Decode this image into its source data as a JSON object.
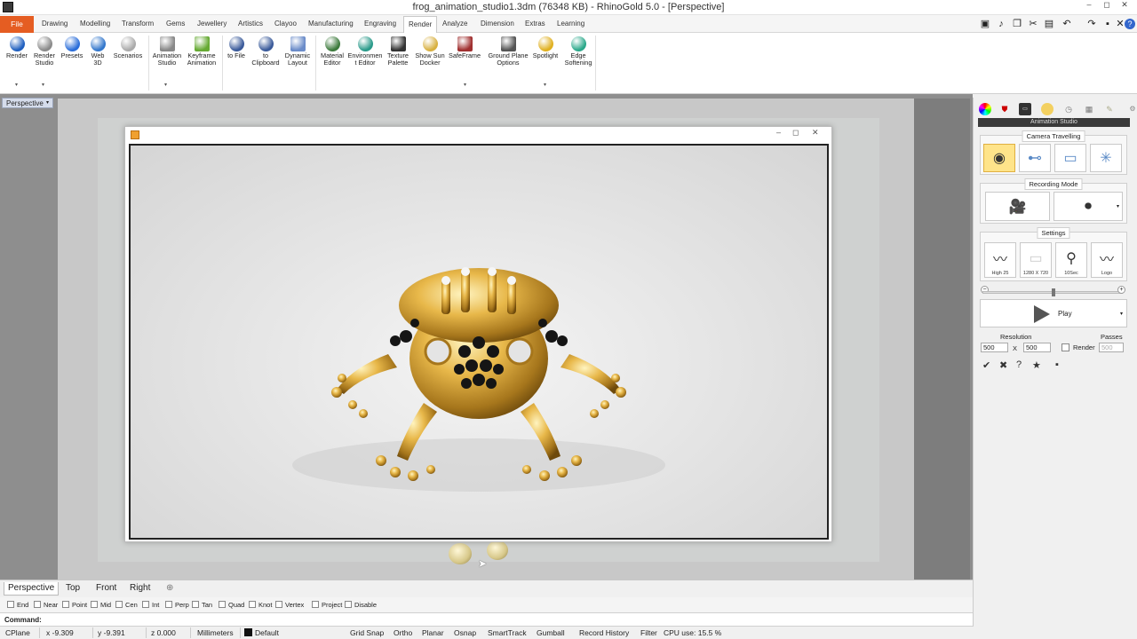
{
  "window": {
    "title": "frog_animation_studio1.3dm (76348 KB) - RhinoGold 5.0 - [Perspective]",
    "controls": [
      "–",
      "◻",
      "✕"
    ]
  },
  "menu": {
    "file": "File",
    "tabs": [
      "Drawing",
      "Modelling",
      "Transform",
      "Gems",
      "Jewellery",
      "Artistics",
      "Clayoo",
      "Manufacturing",
      "Engraving",
      "Render",
      "Analyze",
      "Dimension",
      "Extras",
      "Learning"
    ],
    "active_tab": "Render"
  },
  "quick_access_icons": [
    "film-icon",
    "microphone-icon",
    "copy-icon",
    "scissors-icon",
    "paste-icon",
    "undo-icon",
    "redo-icon",
    "save-icon",
    "close-icon",
    "help-icon"
  ],
  "ribbon": {
    "buttons": [
      {
        "label": "Render",
        "icon": "render-sphere-icon",
        "color": "#1f5fbf"
      },
      {
        "label": "Render\nStudio",
        "icon": "render-studio-icon",
        "color": "#8a8a8a"
      },
      {
        "label": "Presets",
        "icon": "presets-icon",
        "color": "#2a6dd9"
      },
      {
        "label": "Web\n3D",
        "icon": "web3d-icon",
        "color": "#3377cc"
      },
      {
        "label": "Scenarios",
        "icon": "scenarios-icon",
        "color": "#aaaaaa"
      },
      {
        "label": "Animation\nStudio",
        "icon": "animation-studio-icon",
        "color": "#888888"
      },
      {
        "label": "Keyframe\nAnimation",
        "icon": "keyframe-icon",
        "color": "#66aa33"
      },
      {
        "label": "to File",
        "icon": "to-file-icon",
        "color": "#3a5a9a"
      },
      {
        "label": "to\nClipboard",
        "icon": "to-clipboard-icon",
        "color": "#3a5a9a"
      },
      {
        "label": "Dynamic\nLayout",
        "icon": "dynamic-layout-icon",
        "color": "#6b8cc9"
      },
      {
        "label": "Material\nEditor",
        "icon": "material-editor-icon",
        "color": "#3c7a3c"
      },
      {
        "label": "Environmen\nt Editor",
        "icon": "environment-editor-icon",
        "color": "#2a9a8a"
      },
      {
        "label": "Texture\nPalette",
        "icon": "texture-palette-icon",
        "color": "#333333"
      },
      {
        "label": "Show Sun\nDocker",
        "icon": "sun-docker-icon",
        "color": "#d8b040"
      },
      {
        "label": "SafeFrame",
        "icon": "safeframe-icon",
        "color": "#a03030"
      },
      {
        "label": "Ground Plane\nOptions",
        "icon": "ground-plane-icon",
        "color": "#555555"
      },
      {
        "label": "Spotlight",
        "icon": "spotlight-icon",
        "color": "#e0b020"
      },
      {
        "label": "Edge\nSoftening",
        "icon": "edge-softening-icon",
        "color": "#2aa88a"
      }
    ]
  },
  "viewport": {
    "active_label": "Perspective",
    "tabs": [
      "Perspective",
      "Top",
      "Front",
      "Right"
    ],
    "add_tab": "⊕"
  },
  "osnap": {
    "items": [
      "End",
      "Near",
      "Point",
      "Mid",
      "Cen",
      "Int",
      "Perp",
      "Tan",
      "Quad",
      "Knot",
      "Vertex",
      "Project",
      "Disable"
    ]
  },
  "command": {
    "label": "Command:"
  },
  "status": {
    "cplane": "CPlane",
    "x": "x -9.309",
    "y": "y -9.391",
    "z": "z 0.000",
    "units": "Millimeters",
    "layer": "Default",
    "toggles": [
      "Grid Snap",
      "Ortho",
      "Planar",
      "Osnap",
      "SmartTrack",
      "Gumball",
      "Record History",
      "Filter"
    ],
    "cpu": "CPU use: 15.5 %"
  },
  "panel": {
    "header": "Animation Studio",
    "tab_icons": [
      "color-wheel-icon",
      "shield-icon",
      "display-icon",
      "sun-icon",
      "clock-icon",
      "calendar-icon",
      "edit-icon"
    ],
    "camera_travelling": {
      "title": "Camera Travelling",
      "buttons": [
        "orbit-camera-icon",
        "pan-camera-icon",
        "slide-camera-icon",
        "explode-camera-icon"
      ]
    },
    "recording_mode": {
      "title": "Recording Mode",
      "buttons": [
        "video-camera-icon",
        "film-camera-icon"
      ]
    },
    "settings": {
      "title": "Settings",
      "buttons": [
        {
          "label": "High 25",
          "icon": "film-strip-icon"
        },
        {
          "label": "1280 X 720",
          "icon": "resolution-icon"
        },
        {
          "label": "10Sec",
          "icon": "timer-icon"
        },
        {
          "label": "Logo",
          "icon": "logo-film-icon"
        }
      ]
    },
    "play_label": "Play",
    "resolution_label": "Resolution",
    "passes_label": "Passes",
    "res_w": "500",
    "res_x": "X",
    "res_h": "500",
    "render_label": "Render",
    "passes": "500",
    "tool_icons": [
      "check-icon",
      "close-icon",
      "help-icon",
      "star-icon",
      "save-icon"
    ]
  }
}
